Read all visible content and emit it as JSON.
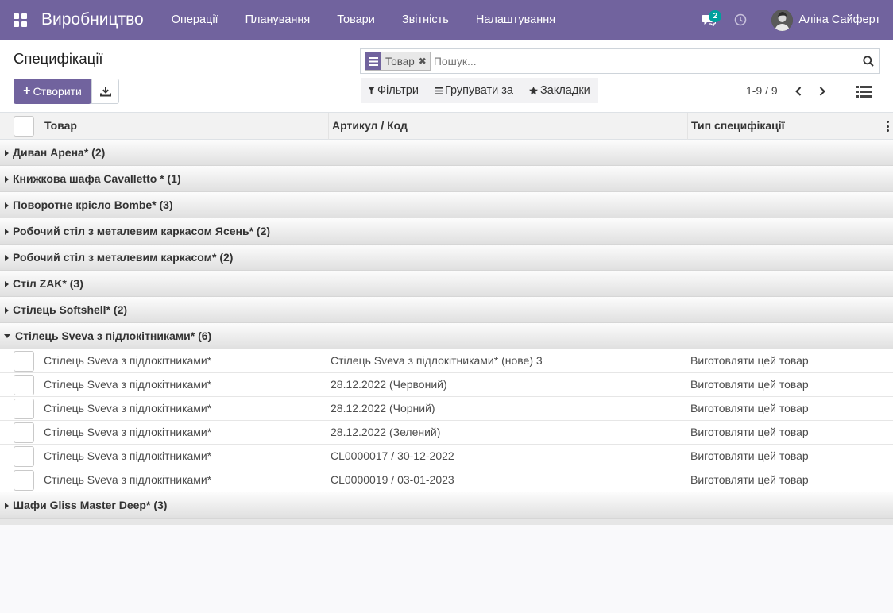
{
  "navbar": {
    "brand": "Виробництво",
    "menu": [
      "Операції",
      "Планування",
      "Товари",
      "Звітність",
      "Налаштування"
    ],
    "messages_count": "2",
    "user_name": "Аліна Сайферт",
    "color": "#71639e"
  },
  "control_panel": {
    "title": "Специфікації",
    "create_label": "Створити",
    "search": {
      "facet_label": "Товар",
      "placeholder": "Пошук..."
    },
    "filters": [
      "Фільтри",
      "Групувати за",
      "Закладки"
    ],
    "pager": "1-9 / 9"
  },
  "table": {
    "columns": [
      "Товар",
      "Артикул / Код",
      "Тип специфікації"
    ],
    "groups": [
      {
        "label": "Диван Арена* (2)",
        "open": false
      },
      {
        "label": "Книжкова шафа Cavalletto * (1)",
        "open": false
      },
      {
        "label": "Поворотне крісло Bombe* (3)",
        "open": false
      },
      {
        "label": "Робочий стіл з металевим каркасом Ясень* (2)",
        "open": false
      },
      {
        "label": "Робочий стіл з металевим каркасом* (2)",
        "open": false
      },
      {
        "label": "Стіл ZAK* (3)",
        "open": false
      },
      {
        "label": "Стілець Softshell* (2)",
        "open": false
      },
      {
        "label": "Стілець Sveva з підлокітниками* (6)",
        "open": true,
        "rows": [
          {
            "product": "Стілець Sveva з підлокітниками*",
            "reference": "Стілець Sveva з підлокітниками* (нове) 3",
            "type": "Виготовляти цей товар"
          },
          {
            "product": "Стілець Sveva з підлокітниками*",
            "reference": "28.12.2022 (Червоний)",
            "type": "Виготовляти цей товар"
          },
          {
            "product": "Стілець Sveva з підлокітниками*",
            "reference": "28.12.2022 (Чорний)",
            "type": "Виготовляти цей товар"
          },
          {
            "product": "Стілець Sveva з підлокітниками*",
            "reference": "28.12.2022 (Зелений)",
            "type": "Виготовляти цей товар"
          },
          {
            "product": "Стілець Sveva з підлокітниками*",
            "reference": "CL0000017 / 30-12-2022",
            "type": "Виготовляти цей товар"
          },
          {
            "product": "Стілець Sveva з підлокітниками*",
            "reference": "CL0000019 / 03-01-2023",
            "type": "Виготовляти цей товар"
          }
        ]
      },
      {
        "label": "Шафи Gliss Master Deep* (3)",
        "open": false
      }
    ]
  }
}
